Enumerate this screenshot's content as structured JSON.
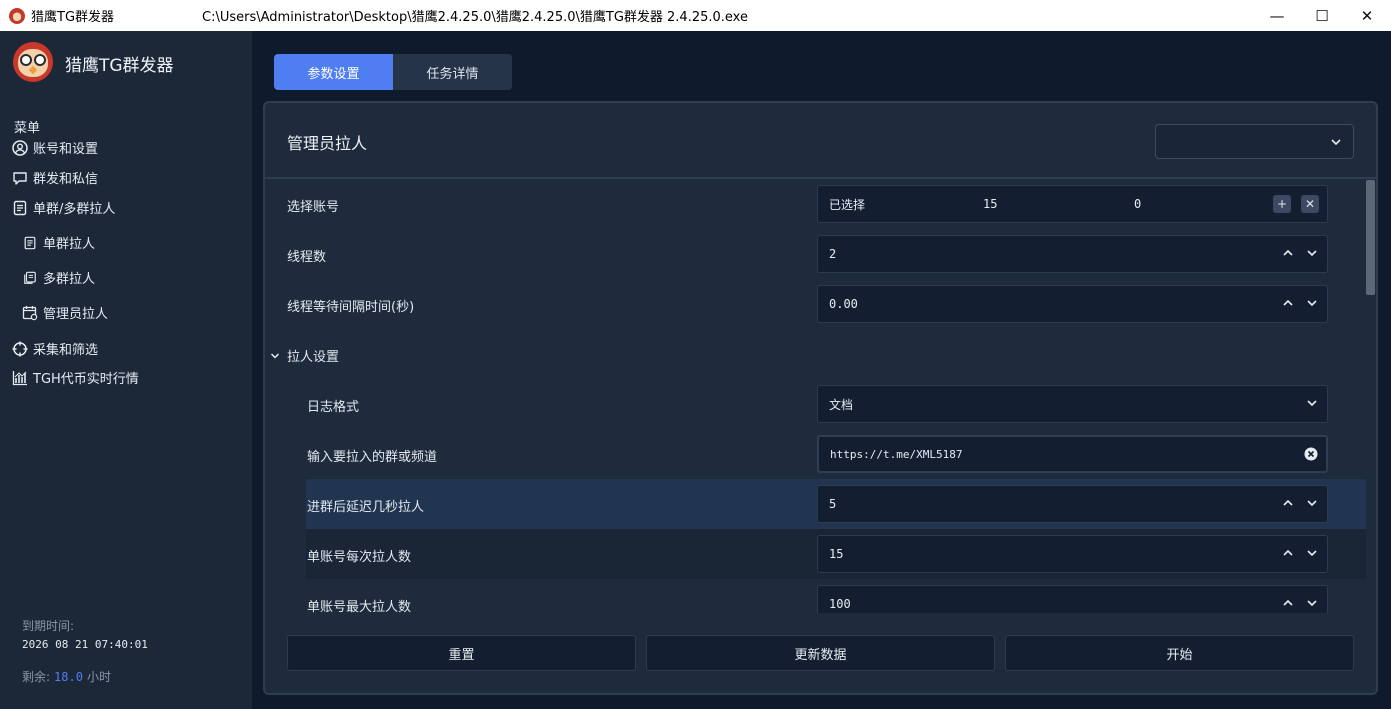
{
  "window": {
    "app_name": "猎鹰TG群发器",
    "path": "C:\\Users\\Administrator\\Desktop\\猎鹰2.4.25.0\\猎鹰2.4.25.0\\猎鹰TG群发器 2.4.25.0.exe",
    "controls": {
      "minimize": "—",
      "maximize": "☐",
      "close": "✕"
    }
  },
  "sidebar": {
    "brand": "猎鹰TG群发器",
    "menu_title": "菜单",
    "items": [
      {
        "label": "账号和设置",
        "icon": "user-circle-icon"
      },
      {
        "label": "群发和私信",
        "icon": "chat-bubble-icon"
      },
      {
        "label": "单群/多群拉人",
        "icon": "document-icon"
      },
      {
        "label": "单群拉人",
        "icon": "document-icon"
      },
      {
        "label": "多群拉人",
        "icon": "documents-icon"
      },
      {
        "label": "管理员拉人",
        "icon": "calendar-gear-icon"
      },
      {
        "label": "采集和筛选",
        "icon": "crosshair-icon"
      },
      {
        "label": "TGH代币实时行情",
        "icon": "chart-icon"
      }
    ],
    "expire_label": "到期时间:",
    "expire_time": "2026 08 21 07:40:01",
    "remain_label": "剩余:",
    "remain_value": "18.0",
    "remain_unit": "小时"
  },
  "tabs": [
    {
      "label": "参数设置",
      "active": true
    },
    {
      "label": "任务详情",
      "active": false
    }
  ],
  "panel": {
    "title": "管理员拉人",
    "mode_select_value": ""
  },
  "form": {
    "account": {
      "label": "选择账号",
      "selected_label": "已选择",
      "count": "15",
      "other": "0"
    },
    "threads": {
      "label": "线程数",
      "value": "2"
    },
    "thread_wait": {
      "label": "线程等待间隔时间(秒)",
      "value": "0.00"
    },
    "section": {
      "label": "拉人设置",
      "chevron": "⌄"
    },
    "log_format": {
      "label": "日志格式",
      "value": "文档"
    },
    "group_input": {
      "label": "输入要拉入的群或频道",
      "value": "https://t.me/XML5187"
    },
    "join_delay": {
      "label": "进群后延迟几秒拉人",
      "value": "5"
    },
    "per_account_each": {
      "label": "单账号每次拉人数",
      "value": "15"
    },
    "per_account_max": {
      "label": "单账号最大拉人数",
      "value": "100"
    }
  },
  "buttons": {
    "reset": "重置",
    "refresh": "更新数据",
    "start": "开始"
  },
  "colors": {
    "accent": "#4f7df2",
    "background": "#0f1b2d",
    "sidebar": "#1c2838",
    "panel": "#1e2b3d"
  }
}
